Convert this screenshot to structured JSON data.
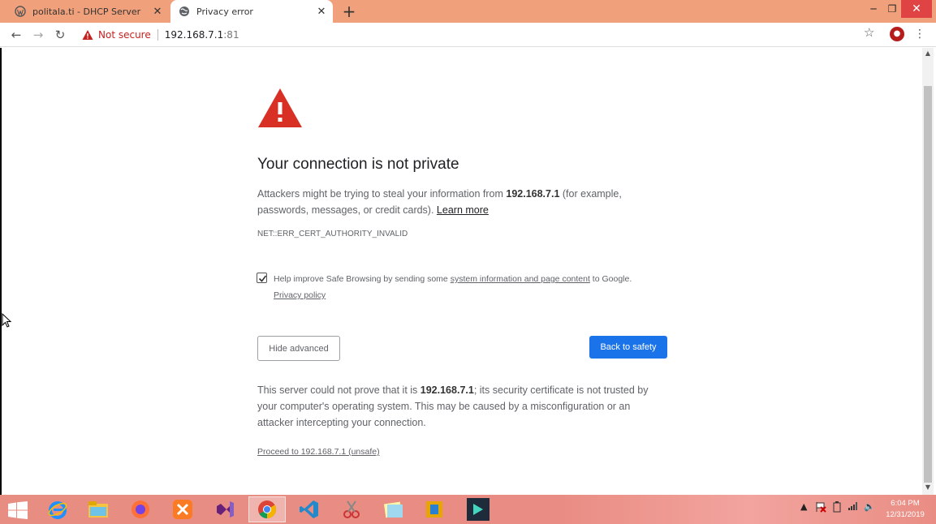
{
  "tabs": [
    {
      "title": "politala.ti - DHCP Server",
      "active": false,
      "icon": "wordpress-icon"
    },
    {
      "title": "Privacy error",
      "active": true,
      "icon": "globe-icon"
    }
  ],
  "toolbar": {
    "security_label": "Not secure",
    "url_host": "192.168.7.1",
    "url_port": ":81"
  },
  "page": {
    "heading": "Your connection is not private",
    "intro_before": "Attackers might be trying to steal your information from ",
    "intro_host": "192.168.7.1",
    "intro_after": " (for example, passwords, messages, or credit cards). ",
    "learn_more": "Learn more",
    "error_code": "NET::ERR_CERT_AUTHORITY_INVALID",
    "checkbox_checked": true,
    "checkbox_before": "Help improve Safe Browsing by sending some ",
    "checkbox_link": "system information and page content",
    "checkbox_after": " to Google.",
    "privacy_policy": "Privacy policy",
    "hide_advanced": "Hide advanced",
    "back_to_safety": "Back to safety",
    "details_before": "This server could not prove that it is ",
    "details_host": "192.168.7.1",
    "details_after": "; its security certificate is not trusted by your computer's operating system. This may be caused by a misconfiguration or an attacker intercepting your connection.",
    "proceed_link": "Proceed to 192.168.7.1 (unsafe)"
  },
  "taskbar": {
    "apps": [
      "internet-explorer-icon",
      "file-explorer-icon",
      "firefox-icon",
      "xampp-icon",
      "visual-studio-icon",
      "chrome-icon",
      "vscode-icon",
      "snipping-tool-icon",
      "sticky-notes-icon",
      "app-icon",
      "filmora-icon"
    ],
    "time": "6:04 PM",
    "date": "12/31/2019"
  },
  "colors": {
    "tabstrip": "#f0a07a",
    "warning_red": "#d93025",
    "primary_button": "#1a73e8",
    "taskbar": "#e88d82"
  }
}
